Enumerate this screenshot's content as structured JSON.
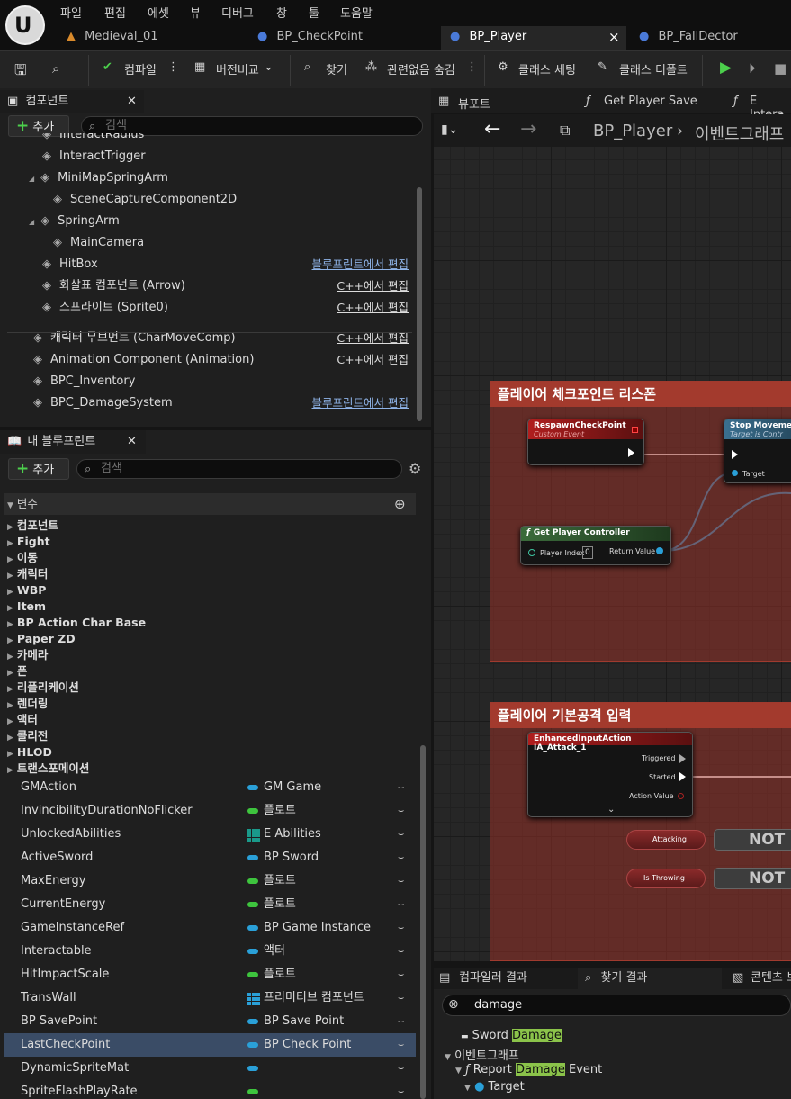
{
  "menu": [
    "파일",
    "편집",
    "에셋",
    "뷰",
    "디버그",
    "창",
    "툴",
    "도움말"
  ],
  "tabs": [
    {
      "label": "Medieval_01",
      "icon": "level-icon"
    },
    {
      "label": "BP_CheckPoint",
      "icon": "blueprint-icon"
    },
    {
      "label": "BP_Player",
      "icon": "blueprint-icon",
      "active": true
    },
    {
      "label": "BP_FallDector",
      "icon": "blueprint-icon"
    }
  ],
  "tab_close": "×",
  "toolbar": {
    "compile": "컴파일",
    "diff": "버전비교",
    "find": "찾기",
    "hide_unrelated": "관련없음 숨김",
    "class_settings": "클래스 세팅",
    "class_defaults": "클래스 디폴트"
  },
  "components_panel": {
    "title": "컴포넌트",
    "add": "추가",
    "search_placeholder": "검색",
    "items": [
      {
        "label": "InteractRadius",
        "indent": 1,
        "cut": true
      },
      {
        "label": "InteractTrigger",
        "indent": 1
      },
      {
        "label": "MiniMapSpringArm",
        "indent": 1,
        "expanded": true
      },
      {
        "label": "SceneCaptureComponent2D",
        "indent": 2
      },
      {
        "label": "SpringArm",
        "indent": 1,
        "expanded": true
      },
      {
        "label": "MainCamera",
        "indent": 2
      },
      {
        "label": "HitBox",
        "indent": 1,
        "edit": "블루프린트에서 편집",
        "edit_style": "blue"
      },
      {
        "label": "화살표 컴포넌트 (Arrow)",
        "indent": 1,
        "edit": "C++에서 편집",
        "edit_style": "white"
      },
      {
        "label": "스프라이트 (Sprite0)",
        "indent": 1,
        "edit": "C++에서 편집",
        "edit_style": "white"
      },
      {
        "label": "캐릭터 무브먼트 (CharMoveComp)",
        "indent": 0,
        "edit": "C++에서 편집",
        "edit_style": "white"
      },
      {
        "label": "Animation Component (Animation)",
        "indent": 0,
        "edit": "C++에서 편집",
        "edit_style": "white"
      },
      {
        "label": "BPC_Inventory",
        "indent": 0
      },
      {
        "label": "BPC_DamageSystem",
        "indent": 0,
        "edit": "블루프린트에서 편집",
        "edit_style": "blue"
      }
    ]
  },
  "my_blueprint": {
    "title": "내 블루프린트",
    "add": "추가",
    "search_placeholder": "검색",
    "section": "변수",
    "categories": [
      "컴포넌트",
      "Fight",
      "이동",
      "캐릭터",
      "WBP",
      "Item",
      "BP Action Char Base",
      "Paper ZD",
      "카메라",
      "폰",
      "리플리케이션",
      "렌더링",
      "액터",
      "콜리전",
      "HLOD",
      "트랜스포메이션"
    ],
    "variables": [
      {
        "name": "GMAction",
        "type": "GM Game",
        "color": "#2aa0d8"
      },
      {
        "name": "InvincibilityDurationNoFlicker",
        "type": "플로트",
        "color": "#3ec43e"
      },
      {
        "name": "UnlockedAbilities",
        "type": "E Abilities",
        "color": "#1a9a8a",
        "grid": true
      },
      {
        "name": "ActiveSword",
        "type": "BP Sword",
        "color": "#2aa0d8"
      },
      {
        "name": "MaxEnergy",
        "type": "플로트",
        "color": "#3ec43e"
      },
      {
        "name": "CurrentEnergy",
        "type": "플로트",
        "color": "#3ec43e"
      },
      {
        "name": "GameInstanceRef",
        "type": "BP Game Instance",
        "color": "#2aa0d8"
      },
      {
        "name": "Interactable",
        "type": "액터",
        "color": "#2aa0d8"
      },
      {
        "name": "HitImpactScale",
        "type": "플로트",
        "color": "#3ec43e"
      },
      {
        "name": "TransWall",
        "type": "프리미티브 컴포넌트",
        "color": "#2aa0d8",
        "grid": true
      },
      {
        "name": "BP SavePoint",
        "type": "BP Save Point",
        "color": "#2aa0d8"
      },
      {
        "name": "LastCheckPoint",
        "type": "BP Check Point",
        "color": "#2aa0d8",
        "selected": true
      },
      {
        "name": "DynamicSpriteMat",
        "type": "",
        "color": "#2aa0d8"
      },
      {
        "name": "SpriteFlashPlayRate",
        "type": "",
        "color": "#3ec43e"
      }
    ]
  },
  "graph_tabs": {
    "viewport": "뷰포트",
    "func1": "Get Player Save",
    "func2": "E Intera"
  },
  "breadcrumb": {
    "bp": "BP_Player",
    "graph": "이벤트그래프"
  },
  "graph": {
    "comment1": "플레이어 체크포인트 리스폰",
    "comment2": "플레이어 기본공격 입력",
    "respawn_node": {
      "title": "RespawnCheckPoint",
      "subtitle": "Custom Event"
    },
    "stop_node": {
      "title": "Stop Moveme",
      "subtitle": "Target is Contr",
      "target": "Target"
    },
    "gpc_node": {
      "title": "Get Player Controller",
      "player_index": "Player Index",
      "index_value": "0",
      "return": "Return Value"
    },
    "input_node": {
      "title": "EnhancedInputAction IA_Attack_1",
      "pins": [
        "Triggered",
        "Started",
        "Action Value"
      ]
    },
    "attacking": "Attacking",
    "is_throwing": "Is Throwing",
    "not_label": "NOT"
  },
  "bottom_tabs": {
    "compiler": "컴파일러 결과",
    "find": "찾기 결과",
    "content": "콘텐츠 브"
  },
  "find_results": {
    "query": "damage",
    "r1_pre": "Sword ",
    "r1_hl": "Damage",
    "r2": "이벤트그래프",
    "r3_pre": "Report ",
    "r3_hl": "Damage",
    "r3_post": " Event",
    "r4": "Target"
  }
}
